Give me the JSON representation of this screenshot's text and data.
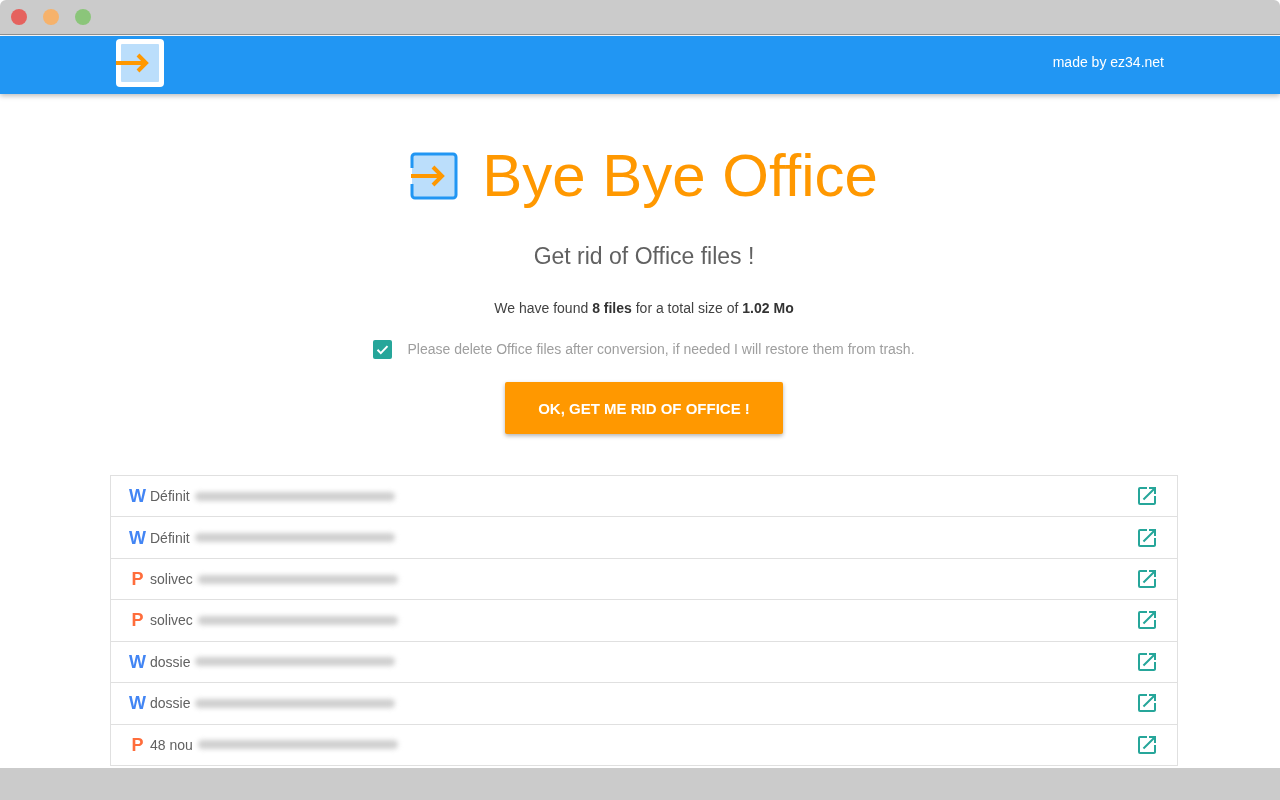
{
  "header": {
    "credit": "made by ez34.net"
  },
  "hero": {
    "title": "Bye Bye Office",
    "subtitle": "Get rid of Office files !"
  },
  "summary": "We have found **8 files** for a total size of **1.02 Mo**",
  "delete_option": {
    "label": "Please delete Office files after conversion, if needed I will restore them from trash.",
    "checked": true
  },
  "action_button": {
    "label": "OK, GET ME RID OF OFFICE !"
  },
  "files": [
    {
      "kind": "word",
      "glyph": "W",
      "name": "Définit"
    },
    {
      "kind": "word",
      "glyph": "W",
      "name": "Définit"
    },
    {
      "kind": "powerpoint",
      "glyph": "P",
      "name": "solivec"
    },
    {
      "kind": "powerpoint",
      "glyph": "P",
      "name": "solivec"
    },
    {
      "kind": "word",
      "glyph": "W",
      "name": "dossie"
    },
    {
      "kind": "word",
      "glyph": "W",
      "name": "dossie"
    },
    {
      "kind": "powerpoint",
      "glyph": "P",
      "name": "48 nou"
    }
  ]
}
